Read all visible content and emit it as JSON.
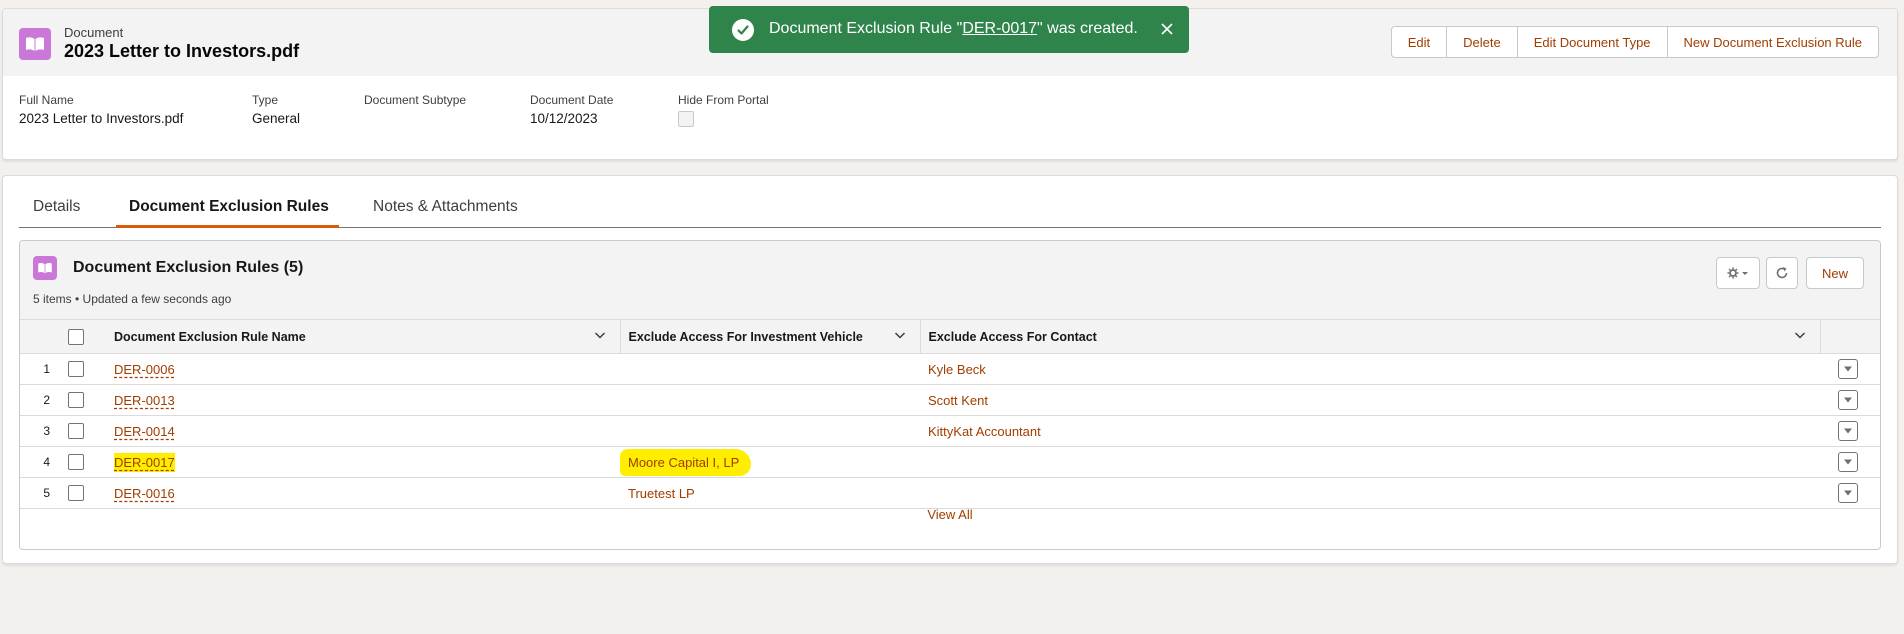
{
  "header": {
    "object_label": "Document",
    "record_title": "2023 Letter to Investors.pdf",
    "actions": [
      "Edit",
      "Delete",
      "Edit Document Type",
      "New Document Exclusion Rule"
    ]
  },
  "fields": [
    {
      "label": "Full Name",
      "value": "2023 Letter to Investors.pdf"
    },
    {
      "label": "Type",
      "value": "General"
    },
    {
      "label": "Document Subtype",
      "value": ""
    },
    {
      "label": "Document Date",
      "value": "10/12/2023"
    },
    {
      "label": "Hide From Portal",
      "value": ""
    }
  ],
  "toast": {
    "prefix": "Document Exclusion Rule \"",
    "link": "DER-0017",
    "suffix": "\" was created.",
    "color": "#2e844a"
  },
  "tabs": [
    "Details",
    "Document Exclusion Rules",
    "Notes & Attachments"
  ],
  "related_list": {
    "title": "Document Exclusion Rules (5)",
    "subtitle": "5 items • Updated a few seconds ago",
    "new_label": "New",
    "columns": [
      "Document Exclusion Rule Name",
      "Exclude Access For Investment Vehicle",
      "Exclude Access For Contact"
    ],
    "rows": [
      {
        "num": "1",
        "name": "DER-0006",
        "vehicle": "",
        "contact": "Kyle Beck"
      },
      {
        "num": "2",
        "name": "DER-0013",
        "vehicle": "",
        "contact": "Scott Kent"
      },
      {
        "num": "3",
        "name": "DER-0014",
        "vehicle": "",
        "contact": "KittyKat Accountant"
      },
      {
        "num": "4",
        "name": "DER-0017",
        "vehicle": "Moore Capital I, LP",
        "contact": ""
      },
      {
        "num": "5",
        "name": "DER-0016",
        "vehicle": "Truetest LP",
        "contact": ""
      }
    ],
    "view_all": "View All"
  },
  "colors": {
    "accent": "#a23d00",
    "object_icon": "#c978d8",
    "highlight": "#ffee00",
    "active_tab": "#d85b0a"
  }
}
